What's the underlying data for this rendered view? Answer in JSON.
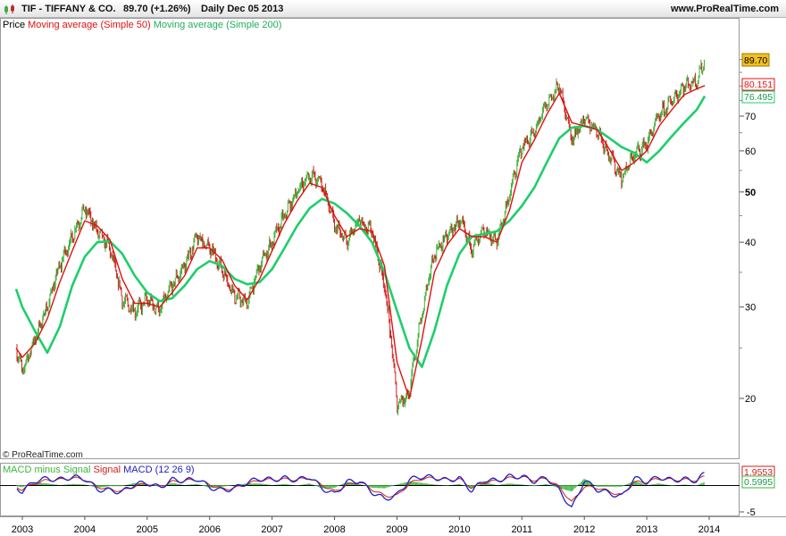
{
  "header": {
    "symbol_title": "TIF - TIFFANY & CO.",
    "price_change": "89.70 (+1.26%)",
    "period_date": "Daily  Dec 05 2013",
    "site": "www.ProRealTime.com"
  },
  "legend": {
    "price": "Price",
    "ma50": "Moving average (Simple 50)",
    "ma200": "Moving average (Simple 200)"
  },
  "credit": "© ProRealTime.com",
  "macd_legend": {
    "hist": "MACD minus Signal",
    "signal": "Signal",
    "macd": "MACD (12 26 9)"
  },
  "price_tags": {
    "last": "89.70",
    "ma50": "80.151",
    "ma200": "76.495"
  },
  "macd_tags": {
    "top": "1.9553",
    "mid": "0.5995",
    "bottom": "-5"
  },
  "colors": {
    "candle_up": "#3cb43c",
    "candle_down": "#d21e1e",
    "ma50": "#e01010",
    "ma200": "#1fce6a",
    "macd": "#2020c0",
    "signal": "#d21e1e",
    "hist": "#3cb43c",
    "last_tag_bg": "#f0c020"
  },
  "chart_data": [
    {
      "type": "line",
      "title": "TIF - TIFFANY & CO.",
      "y_scale": "log",
      "y_ticks": [
        20,
        30,
        40,
        50,
        60,
        70
      ],
      "x_ticks": [
        "2003",
        "2004",
        "2005",
        "2006",
        "2007",
        "2008",
        "2009",
        "2010",
        "2011",
        "2012",
        "2013",
        "2014"
      ],
      "x": [
        2002.9,
        2003.0,
        2003.2,
        2003.4,
        2003.6,
        2003.8,
        2004.0,
        2004.2,
        2004.4,
        2004.6,
        2004.8,
        2005.0,
        2005.2,
        2005.4,
        2005.6,
        2005.8,
        2006.0,
        2006.2,
        2006.4,
        2006.6,
        2006.8,
        2007.0,
        2007.2,
        2007.4,
        2007.6,
        2007.8,
        2008.0,
        2008.2,
        2008.4,
        2008.6,
        2008.8,
        2009.0,
        2009.2,
        2009.4,
        2009.6,
        2009.8,
        2010.0,
        2010.2,
        2010.4,
        2010.6,
        2010.8,
        2011.0,
        2011.2,
        2011.4,
        2011.6,
        2011.8,
        2012.0,
        2012.2,
        2012.4,
        2012.6,
        2012.8,
        2013.0,
        2013.2,
        2013.4,
        2013.6,
        2013.8,
        2013.93
      ],
      "series": [
        {
          "name": "Price",
          "values": [
            25.0,
            22.5,
            26.0,
            30.0,
            36.0,
            41.0,
            46.5,
            42.0,
            39.0,
            31.0,
            29.5,
            31.0,
            29.5,
            33.0,
            36.0,
            41.0,
            39.0,
            35.5,
            31.5,
            30.5,
            36.0,
            40.0,
            45.0,
            50.0,
            54.0,
            52.0,
            43.0,
            40.0,
            44.0,
            42.0,
            33.0,
            19.5,
            20.5,
            29.0,
            38.0,
            41.0,
            44.0,
            39.0,
            42.0,
            40.0,
            49.0,
            61.0,
            65.0,
            74.0,
            80.0,
            63.0,
            69.0,
            66.0,
            59.0,
            53.0,
            59.0,
            62.0,
            70.0,
            75.0,
            80.0,
            82.0,
            89.7
          ]
        },
        {
          "name": "Moving average (Simple 50)",
          "values": [
            25.0,
            24.0,
            25.5,
            28.5,
            33.5,
            38.5,
            44.0,
            43.0,
            40.5,
            34.0,
            30.5,
            30.5,
            30.0,
            32.0,
            34.5,
            39.0,
            39.0,
            37.0,
            33.0,
            31.0,
            34.0,
            38.5,
            43.5,
            48.0,
            52.0,
            51.0,
            45.0,
            41.0,
            42.5,
            42.0,
            36.0,
            23.5,
            20.0,
            26.0,
            35.0,
            39.5,
            42.5,
            41.0,
            41.0,
            40.0,
            46.0,
            57.0,
            63.0,
            70.5,
            77.5,
            68.0,
            67.0,
            66.0,
            60.5,
            55.0,
            57.0,
            60.0,
            67.0,
            72.0,
            77.0,
            79.0,
            80.151
          ]
        },
        {
          "name": "Moving average (Simple 200)",
          "values": [
            32.5,
            30.0,
            27.0,
            24.5,
            27.5,
            33.0,
            37.5,
            40.0,
            40.2,
            38.0,
            34.5,
            32.0,
            30.8,
            31.2,
            33.0,
            35.5,
            36.8,
            36.0,
            34.0,
            33.2,
            33.5,
            35.5,
            39.0,
            43.0,
            46.5,
            48.5,
            47.5,
            45.5,
            43.0,
            40.0,
            35.0,
            29.5,
            25.0,
            23.0,
            27.0,
            33.0,
            38.0,
            41.0,
            41.5,
            42.0,
            44.0,
            47.0,
            51.0,
            57.0,
            63.5,
            66.5,
            67.0,
            66.0,
            63.5,
            61.0,
            59.5,
            57.0,
            60.0,
            64.0,
            68.0,
            72.0,
            76.495
          ]
        }
      ]
    },
    {
      "type": "line",
      "title": "MACD (12 26 9)",
      "ylim": [
        -5,
        3
      ],
      "y_ticks": [
        -5
      ],
      "x_ticks": [
        "2003",
        "2004",
        "2005",
        "2006",
        "2007",
        "2008",
        "2009",
        "2010",
        "2011",
        "2012",
        "2013",
        "2014"
      ],
      "x": [
        2002.9,
        2003.0,
        2003.2,
        2003.4,
        2003.6,
        2003.8,
        2004.0,
        2004.2,
        2004.4,
        2004.6,
        2004.8,
        2005.0,
        2005.2,
        2005.4,
        2005.6,
        2005.8,
        2006.0,
        2006.2,
        2006.4,
        2006.6,
        2006.8,
        2007.0,
        2007.2,
        2007.4,
        2007.6,
        2007.8,
        2008.0,
        2008.2,
        2008.4,
        2008.6,
        2008.8,
        2009.0,
        2009.2,
        2009.4,
        2009.6,
        2009.8,
        2010.0,
        2010.2,
        2010.4,
        2010.6,
        2010.8,
        2011.0,
        2011.2,
        2011.4,
        2011.6,
        2011.8,
        2012.0,
        2012.2,
        2012.4,
        2012.6,
        2012.8,
        2013.0,
        2013.2,
        2013.4,
        2013.6,
        2013.8,
        2013.93
      ],
      "series": [
        {
          "name": "MACD (12 26 9)",
          "values": [
            -0.5,
            -1.2,
            0.8,
            1.2,
            1.0,
            1.5,
            1.2,
            -0.8,
            -1.0,
            -1.3,
            0.2,
            0.4,
            -0.5,
            1.0,
            0.8,
            1.2,
            -0.4,
            -1.0,
            -0.6,
            0.5,
            1.2,
            1.0,
            1.3,
            0.9,
            1.6,
            -0.6,
            -1.7,
            0.6,
            0.8,
            -1.3,
            -2.6,
            -1.9,
            1.0,
            1.6,
            1.4,
            0.9,
            1.3,
            -1.1,
            1.0,
            0.8,
            1.6,
            1.6,
            0.7,
            1.4,
            -1.0,
            -4.4,
            0.9,
            -0.8,
            -1.5,
            -2.2,
            1.3,
            0.6,
            1.5,
            0.9,
            1.1,
            0.8,
            2.2
          ]
        },
        {
          "name": "Signal",
          "values": [
            -0.3,
            -0.8,
            0.3,
            0.9,
            1.0,
            1.3,
            1.1,
            -0.3,
            -0.8,
            -1.1,
            -0.2,
            0.3,
            -0.2,
            0.6,
            0.8,
            1.0,
            0.1,
            -0.7,
            -0.6,
            0.2,
            0.9,
            1.0,
            1.1,
            1.0,
            1.3,
            0.0,
            -1.2,
            0.0,
            0.6,
            -0.8,
            -2.0,
            -2.0,
            0.3,
            1.2,
            1.3,
            1.0,
            1.1,
            -0.5,
            0.5,
            0.8,
            1.3,
            1.5,
            0.9,
            1.2,
            -0.4,
            -3.2,
            -0.3,
            -0.5,
            -1.2,
            -1.9,
            0.5,
            0.6,
            1.2,
            1.0,
            1.0,
            0.9,
            1.6
          ]
        }
      ]
    }
  ]
}
